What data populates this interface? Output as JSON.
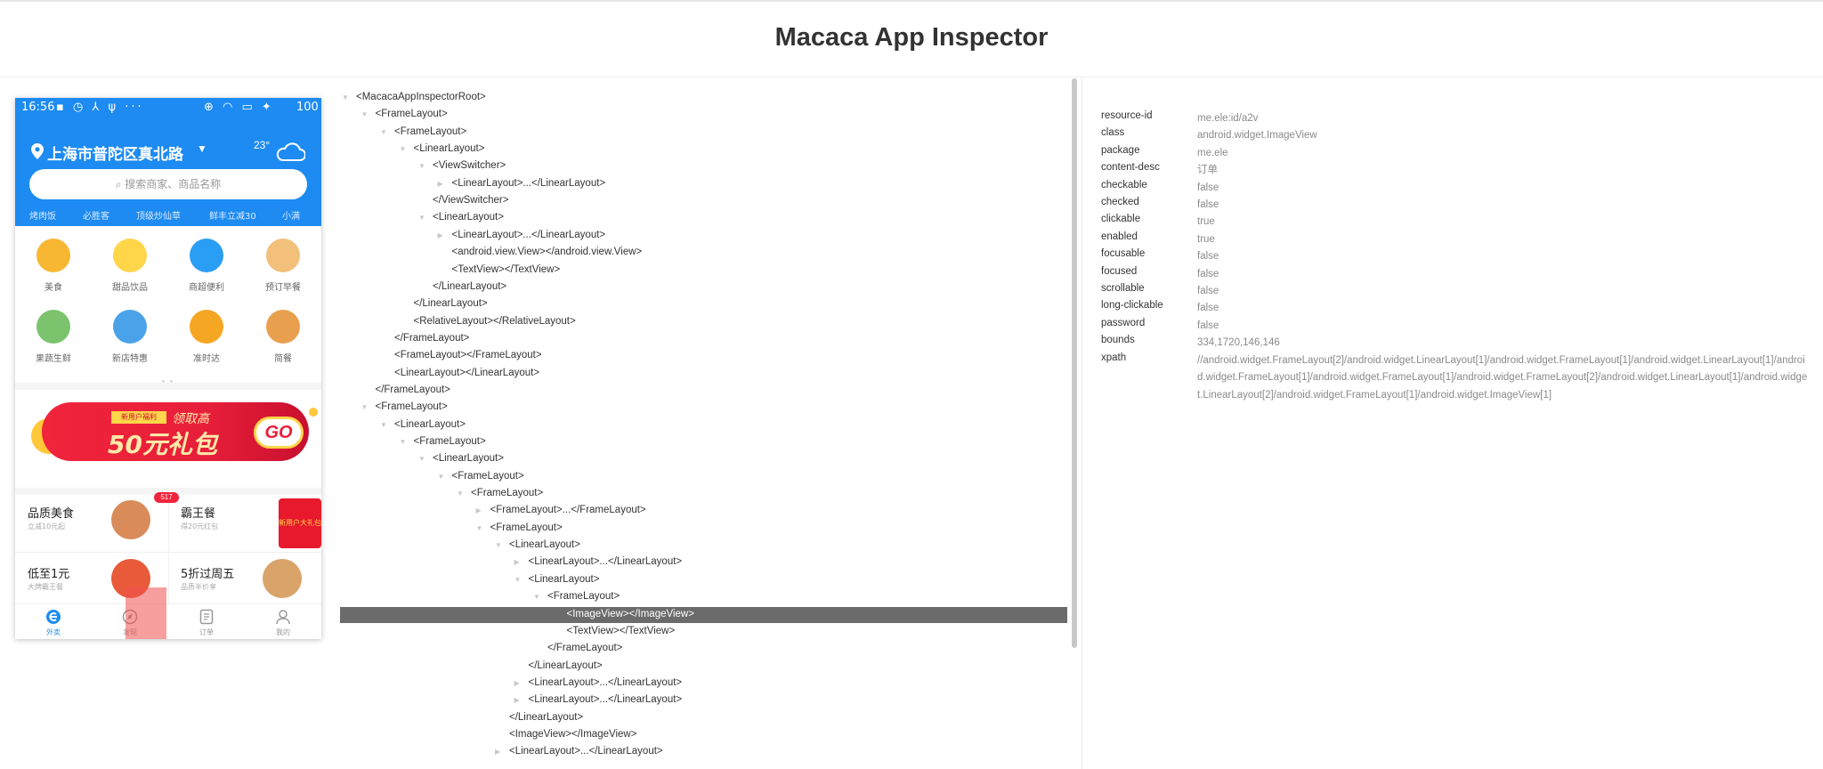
{
  "app": {
    "title": "Macaca App Inspector"
  },
  "device": {
    "status_time": "16:56",
    "status_icons_left": "▪ ◷ ⅄ ψ ···",
    "status_icons_right": "⊕ ◠ ▭ ✦",
    "battery": "100",
    "location": "上海市普陀区真北路",
    "temperature": "23°",
    "search_placeholder": "搜索商家、商品名称",
    "hot_words": [
      "烤肉饭",
      "必胜客",
      "顶级炒仙草",
      "鲜丰立减30",
      "小满"
    ],
    "categories": [
      {
        "label": "美食",
        "color": "#f7b733"
      },
      {
        "label": "甜品饮品",
        "color": "#ffd54a"
      },
      {
        "label": "商超便利",
        "color": "#2a9df4"
      },
      {
        "label": "预订早餐",
        "color": "#f2c07a"
      },
      {
        "label": "果蔬生鲜",
        "color": "#7cc36e"
      },
      {
        "label": "新店特惠",
        "color": "#4aa3e8"
      },
      {
        "label": "准时达",
        "color": "#f5a623"
      },
      {
        "label": "简餐",
        "color": "#e8a04f"
      }
    ],
    "page_dots": "• •",
    "banner": {
      "tag": "新用户福利",
      "subtitle": "领取高",
      "main": "50元礼包",
      "go": "GO"
    },
    "promos": [
      {
        "title": "品质美食",
        "subtitle": "立减10元起",
        "badge": "517"
      },
      {
        "title": "霸王餐",
        "subtitle": "得20元红包",
        "gift": "新用户大礼包"
      },
      {
        "title": "低至1元",
        "subtitle": "大牌霸王餐"
      },
      {
        "title": "5折过周五",
        "subtitle": "品质半价享"
      }
    ],
    "tabs": [
      {
        "label": "外卖",
        "icon": "e-logo-icon",
        "active": true
      },
      {
        "label": "发现",
        "icon": "compass-icon",
        "active": false
      },
      {
        "label": "订单",
        "icon": "order-list-icon",
        "active": false
      },
      {
        "label": "我的",
        "icon": "user-icon",
        "active": false
      }
    ]
  },
  "tree": [
    {
      "text": "<MacacaAppInspectorRoot>",
      "depth": 0,
      "arrow": "open"
    },
    {
      "text": "<FrameLayout>",
      "depth": 1,
      "arrow": "open"
    },
    {
      "text": "<FrameLayout>",
      "depth": 2,
      "arrow": "open"
    },
    {
      "text": "<LinearLayout>",
      "depth": 3,
      "arrow": "open"
    },
    {
      "text": "<ViewSwitcher>",
      "depth": 4,
      "arrow": "open"
    },
    {
      "text": "<LinearLayout>...</LinearLayout>",
      "depth": 5,
      "arrow": "closed"
    },
    {
      "text": "</ViewSwitcher>",
      "depth": 4,
      "arrow": "none"
    },
    {
      "text": "<LinearLayout>",
      "depth": 4,
      "arrow": "open"
    },
    {
      "text": "<LinearLayout>...</LinearLayout>",
      "depth": 5,
      "arrow": "closed"
    },
    {
      "text": "<android.view.View></android.view.View>",
      "depth": 5,
      "arrow": "none"
    },
    {
      "text": "<TextView></TextView>",
      "depth": 5,
      "arrow": "none"
    },
    {
      "text": "</LinearLayout>",
      "depth": 4,
      "arrow": "none"
    },
    {
      "text": "</LinearLayout>",
      "depth": 3,
      "arrow": "none"
    },
    {
      "text": "<RelativeLayout></RelativeLayout>",
      "depth": 3,
      "arrow": "none"
    },
    {
      "text": "</FrameLayout>",
      "depth": 2,
      "arrow": "none"
    },
    {
      "text": "<FrameLayout></FrameLayout>",
      "depth": 2,
      "arrow": "none"
    },
    {
      "text": "<LinearLayout></LinearLayout>",
      "depth": 2,
      "arrow": "none"
    },
    {
      "text": "</FrameLayout>",
      "depth": 1,
      "arrow": "none"
    },
    {
      "text": "<FrameLayout>",
      "depth": 1,
      "arrow": "open"
    },
    {
      "text": "<LinearLayout>",
      "depth": 2,
      "arrow": "open"
    },
    {
      "text": "<FrameLayout>",
      "depth": 3,
      "arrow": "open"
    },
    {
      "text": "<LinearLayout>",
      "depth": 4,
      "arrow": "open"
    },
    {
      "text": "<FrameLayout>",
      "depth": 5,
      "arrow": "open"
    },
    {
      "text": "<FrameLayout>",
      "depth": 6,
      "arrow": "open"
    },
    {
      "text": "<FrameLayout>...</FrameLayout>",
      "depth": 7,
      "arrow": "closed"
    },
    {
      "text": "<FrameLayout>",
      "depth": 7,
      "arrow": "open"
    },
    {
      "text": "<LinearLayout>",
      "depth": 8,
      "arrow": "open"
    },
    {
      "text": "<LinearLayout>...</LinearLayout>",
      "depth": 9,
      "arrow": "closed"
    },
    {
      "text": "<LinearLayout>",
      "depth": 9,
      "arrow": "open"
    },
    {
      "text": "<FrameLayout>",
      "depth": 10,
      "arrow": "open"
    },
    {
      "text": "<ImageView></ImageView>",
      "depth": 11,
      "arrow": "none",
      "selected": true
    },
    {
      "text": "<TextView></TextView>",
      "depth": 11,
      "arrow": "none"
    },
    {
      "text": "</FrameLayout>",
      "depth": 10,
      "arrow": "none"
    },
    {
      "text": "</LinearLayout>",
      "depth": 9,
      "arrow": "none"
    },
    {
      "text": "<LinearLayout>...</LinearLayout>",
      "depth": 9,
      "arrow": "closed"
    },
    {
      "text": "<LinearLayout>...</LinearLayout>",
      "depth": 9,
      "arrow": "closed"
    },
    {
      "text": "</LinearLayout>",
      "depth": 8,
      "arrow": "none"
    },
    {
      "text": "<ImageView></ImageView>",
      "depth": 8,
      "arrow": "none"
    },
    {
      "text": "<LinearLayout>...</LinearLayout>",
      "depth": 8,
      "arrow": "closed"
    }
  ],
  "properties": [
    {
      "key": "resource-id",
      "value": "me.ele:id/a2v"
    },
    {
      "key": "class",
      "value": "android.widget.ImageView"
    },
    {
      "key": "package",
      "value": "me.ele"
    },
    {
      "key": "content-desc",
      "value": "订单"
    },
    {
      "key": "checkable",
      "value": "false"
    },
    {
      "key": "checked",
      "value": "false"
    },
    {
      "key": "clickable",
      "value": "true"
    },
    {
      "key": "enabled",
      "value": "true"
    },
    {
      "key": "focusable",
      "value": "false"
    },
    {
      "key": "focused",
      "value": "false"
    },
    {
      "key": "scrollable",
      "value": "false"
    },
    {
      "key": "long-clickable",
      "value": "false"
    },
    {
      "key": "password",
      "value": "false"
    },
    {
      "key": "bounds",
      "value": "334,1720,146,146"
    },
    {
      "key": "xpath",
      "value": "//android.widget.FrameLayout[2]/android.widget.LinearLayout[1]/android.widget.FrameLayout[1]/android.widget.LinearLayout[1]/android.widget.FrameLayout[1]/android.widget.FrameLayout[1]/android.widget.FrameLayout[2]/android.widget.LinearLayout[1]/android.widget.LinearLayout[2]/android.widget.FrameLayout[1]/android.widget.ImageView[1]"
    }
  ],
  "colors": {
    "brand_blue": "#1d8bf1",
    "selection": "#6b6b6b",
    "banner_red": "#f0243b"
  }
}
